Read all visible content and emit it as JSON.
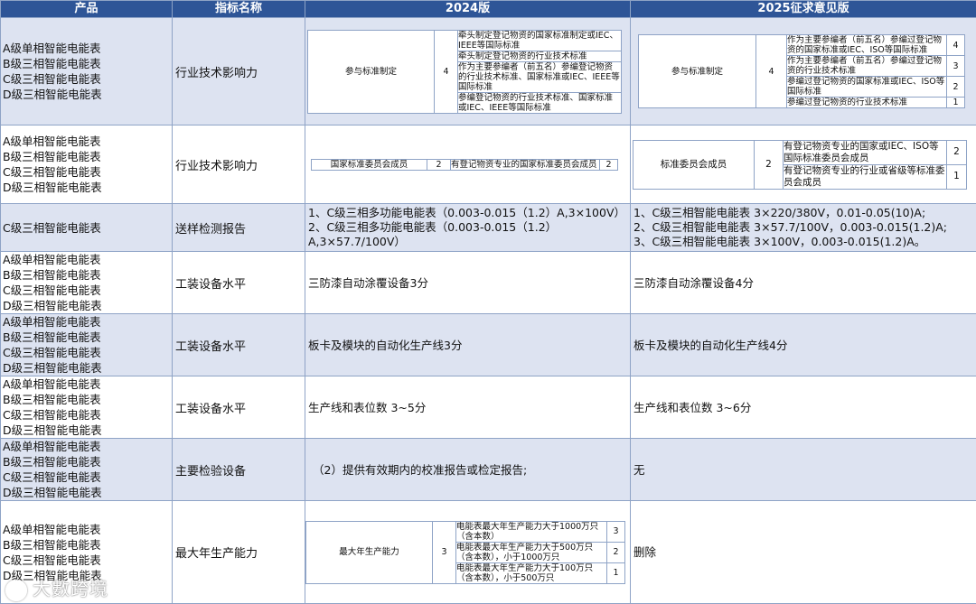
{
  "header": {
    "product": "产品",
    "indicator": "指标名称",
    "v2024": "2024版",
    "v2025": "2025征求意见版"
  },
  "products4": [
    "A级单相智能电能表",
    "B级三相智能电能表",
    "C级三相智能电能表",
    "D级三相智能电能表"
  ],
  "rows": [
    {
      "indicator": "行业技术影响力",
      "v2024": {
        "name": "参与标准制定",
        "score": "4",
        "items": [
          "牵头制定登记物资的国家标准制定或IEC、IEEE等国际标准",
          "牵头制定登记物资的行业技术标准",
          "作为主要参编者（前五名）参编登记物资的行业技术标准、国家标准或IEC、IEEE等国际标准",
          "参编登记物资的行业技术标准、国家标准或IEC、IEEE等国际标准"
        ]
      },
      "v2025": {
        "name": "参与标准制定",
        "score": "4",
        "items": [
          {
            "text": "作为主要参编者（前五名）参编过登记物资的国家标准或IEC、ISO等国际标准",
            "score": "4"
          },
          {
            "text": "作为主要参编者（前五名）参编过登记物资的行业技术标准",
            "score": "3"
          },
          {
            "text": "参编过登记物资的国家标准或IEC、ISO等国际标准",
            "score": "2"
          },
          {
            "text": "参编过登记物资的行业技术标准",
            "score": "1"
          }
        ]
      }
    },
    {
      "indicator": "行业技术影响力",
      "v2024": {
        "name": "国家标准委员会成员",
        "score": "2",
        "item": "有登记物资专业的国家标准委员会成员",
        "item_score": "2"
      },
      "v2025": {
        "name": "标准委员会成员",
        "score": "2",
        "items": [
          {
            "text": "有登记物资专业的国家或IEC、ISO等国际标准委员会成员",
            "score": "2"
          },
          {
            "text": "有登记物资专业的行业或省级等标准委员会成员",
            "score": "1"
          }
        ]
      }
    },
    {
      "product": "C级三相智能电能表",
      "indicator": "送样检测报告",
      "v2024": "1、C级三相多功能电能表（0.003-0.015（1.2）A,3×100V）\n2、C级三相多功能电能表（0.003-0.015（1.2）A,3×57.7/100V）",
      "v2025": "1、C级三相智能电能表 3×220/380V，0.01-0.05(10)A;\n2、C级三相智能电能表 3×57.7/100V，0.003-0.015(1.2)A;\n3、C级三相智能电能表 3×100V，0.003-0.015(1.2)A。"
    },
    {
      "indicator": "工装设备水平",
      "v2024": "三防漆自动涂覆设备3分",
      "v2025": "三防漆自动涂覆设备4分"
    },
    {
      "indicator": "工装设备水平",
      "v2024": "板卡及模块的自动化生产线3分",
      "v2025": "板卡及模块的自动化生产线4分"
    },
    {
      "indicator": "工装设备水平",
      "v2024": "生产线和表位数 3~5分",
      "v2025": "生产线和表位数 3~6分"
    },
    {
      "indicator": "主要检验设备",
      "v2024": "（2）提供有效期内的校准报告或检定报告;",
      "v2025": "无"
    },
    {
      "indicator": "最大年生产能力",
      "v2024": {
        "name": "最大年生产能力",
        "score": "3",
        "items": [
          {
            "text": "电能表最大年生产能力大于1000万只（含本数）",
            "score": "3"
          },
          {
            "text": "电能表最大年生产能力大于500万只（含本数），小于1000万只",
            "score": "2"
          },
          {
            "text": "电能表最大年生产能力大于100万只（含本数），小于500万只",
            "score": "1"
          }
        ]
      },
      "v2025": "删除"
    }
  ],
  "watermark": "大數跨境",
  "colors": {
    "header_bg": "#2e5597",
    "alt_row_bg": "#dde3f1",
    "border": "#8ea3c6"
  }
}
